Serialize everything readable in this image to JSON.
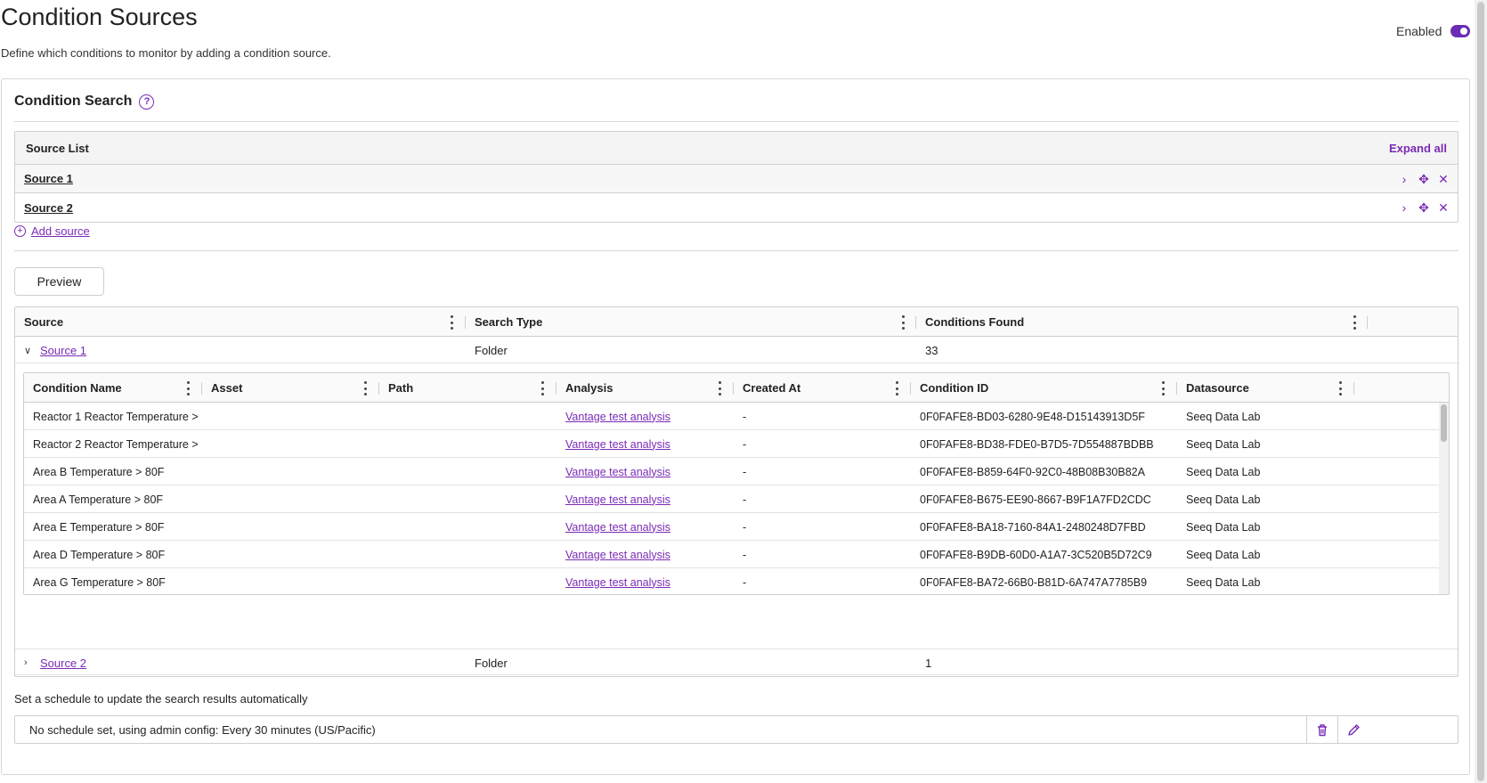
{
  "header": {
    "title": "Condition Sources",
    "subtitle": "Define which conditions to monitor by adding a condition source.",
    "enabled_label": "Enabled"
  },
  "search": {
    "title": "Condition Search",
    "help_icon": "question-circle-icon"
  },
  "source_list": {
    "title": "Source List",
    "expand_all": "Expand all",
    "items": [
      {
        "label": "Source 1"
      },
      {
        "label": "Source 2"
      }
    ],
    "add_source": "Add source"
  },
  "preview_label": "Preview",
  "results": {
    "columns": [
      "Source",
      "Search Type",
      "Conditions Found"
    ],
    "rows": [
      {
        "source": "Source 1",
        "type": "Folder",
        "count": "33",
        "expanded": true
      },
      {
        "source": "Source 2",
        "type": "Folder",
        "count": "1",
        "expanded": false
      }
    ]
  },
  "conditions": {
    "columns": [
      "Condition Name",
      "Asset",
      "Path",
      "Analysis",
      "Created At",
      "Condition ID",
      "Datasource"
    ],
    "rows": [
      {
        "name": "Reactor 1 Reactor Temperature > ...",
        "asset": "",
        "path": "",
        "analysis": "Vantage test analysis",
        "created": "-",
        "id": "0F0FAFE8-BD03-6280-9E48-D15143913D5F",
        "datasource": "Seeq Data Lab"
      },
      {
        "name": "Reactor 2 Reactor Temperature > ...",
        "asset": "",
        "path": "",
        "analysis": "Vantage test analysis",
        "created": "-",
        "id": "0F0FAFE8-BD38-FDE0-B7D5-7D554887BDBB",
        "datasource": "Seeq Data Lab"
      },
      {
        "name": "Area B Temperature > 80F",
        "asset": "",
        "path": "",
        "analysis": "Vantage test analysis",
        "created": "-",
        "id": "0F0FAFE8-B859-64F0-92C0-48B08B30B82A",
        "datasource": "Seeq Data Lab"
      },
      {
        "name": "Area A Temperature > 80F",
        "asset": "",
        "path": "",
        "analysis": "Vantage test analysis",
        "created": "-",
        "id": "0F0FAFE8-B675-EE90-8667-B9F1A7FD2CDC",
        "datasource": "Seeq Data Lab"
      },
      {
        "name": "Area E Temperature > 80F",
        "asset": "",
        "path": "",
        "analysis": "Vantage test analysis",
        "created": "-",
        "id": "0F0FAFE8-BA18-7160-84A1-2480248D7FBD",
        "datasource": "Seeq Data Lab"
      },
      {
        "name": "Area D Temperature > 80F",
        "asset": "",
        "path": "",
        "analysis": "Vantage test analysis",
        "created": "-",
        "id": "0F0FAFE8-B9DB-60D0-A1A7-3C520B5D72C9",
        "datasource": "Seeq Data Lab"
      },
      {
        "name": "Area G Temperature > 80F",
        "asset": "",
        "path": "",
        "analysis": "Vantage test analysis",
        "created": "-",
        "id": "0F0FAFE8-BA72-66B0-B81D-6A747A7785B9",
        "datasource": "Seeq Data Lab"
      }
    ]
  },
  "schedule": {
    "label": "Set a schedule to update the search results automatically",
    "value": "No schedule set, using admin config: Every 30 minutes (US/Pacific)"
  },
  "colors": {
    "accent": "#7a2bb5",
    "border": "#cfcfcf"
  }
}
